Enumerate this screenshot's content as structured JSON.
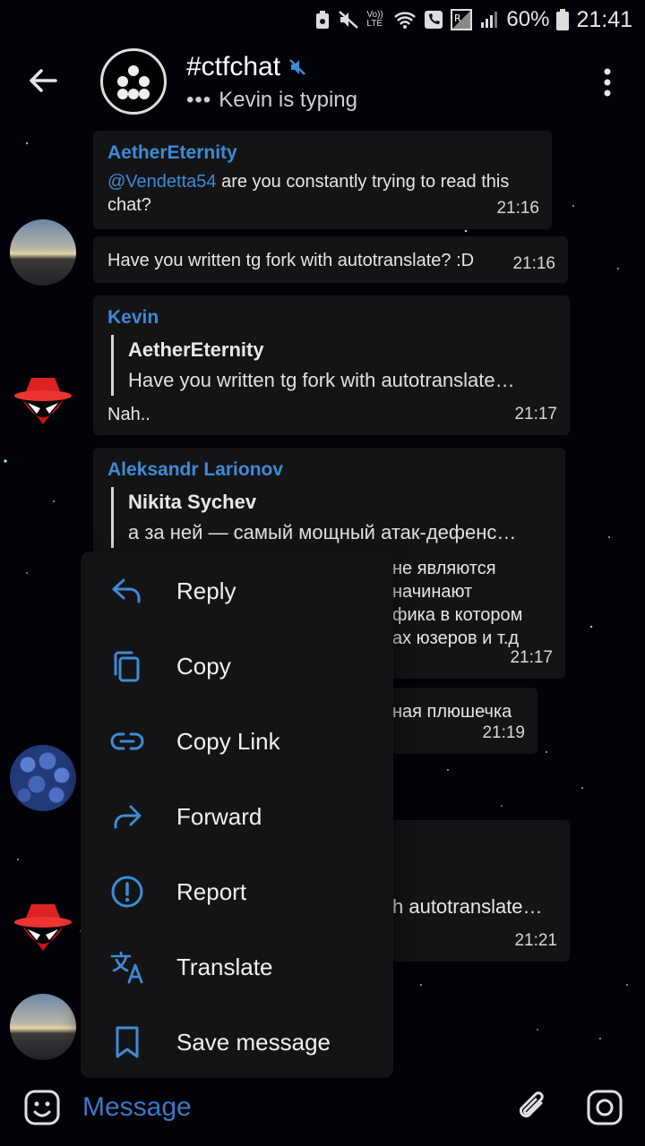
{
  "status_bar": {
    "battery": "60%",
    "time": "21:41",
    "volte_label": "Vo)) LTE"
  },
  "header": {
    "title": "#ctfchat",
    "typing_status": "Kevin is typing",
    "typing_dots": "•••"
  },
  "messages": [
    {
      "sender": "AetherEternity",
      "mention": "@Vendetta54",
      "text": " are you constantly trying to read this chat?",
      "time": "21:16"
    },
    {
      "text": "Have you written tg fork with autotranslate? :D",
      "time": "21:16"
    },
    {
      "sender": "Kevin",
      "quote_name": "AetherEternity",
      "quote_text": "Have you written tg fork with autotranslate…",
      "text": "Nah..",
      "time": "21:17"
    },
    {
      "sender": "Aleksandr Larionov",
      "quote_name": "Nikita Sychev",
      "quote_text": "а за ней — самый мощный атак-дефенс…",
      "lines": [
        "не являются",
        "начинают",
        "фика в котором",
        "ах юзеров и т.д"
      ],
      "time": "21:17"
    },
    {
      "text": "ная плюшечка",
      "time": "21:19"
    },
    {
      "text": "h autotranslate…",
      "time": "21:21"
    }
  ],
  "context_menu": {
    "items": [
      {
        "label": "Reply",
        "icon": "reply-icon"
      },
      {
        "label": "Copy",
        "icon": "copy-icon"
      },
      {
        "label": "Copy Link",
        "icon": "link-icon"
      },
      {
        "label": "Forward",
        "icon": "forward-icon"
      },
      {
        "label": "Report",
        "icon": "report-icon"
      },
      {
        "label": "Translate",
        "icon": "translate-icon"
      },
      {
        "label": "Save message",
        "icon": "bookmark-icon"
      }
    ]
  },
  "input": {
    "placeholder": "Message"
  },
  "colors": {
    "accent": "#3d8bd6",
    "bubble": "#141416",
    "background": "#020308"
  }
}
